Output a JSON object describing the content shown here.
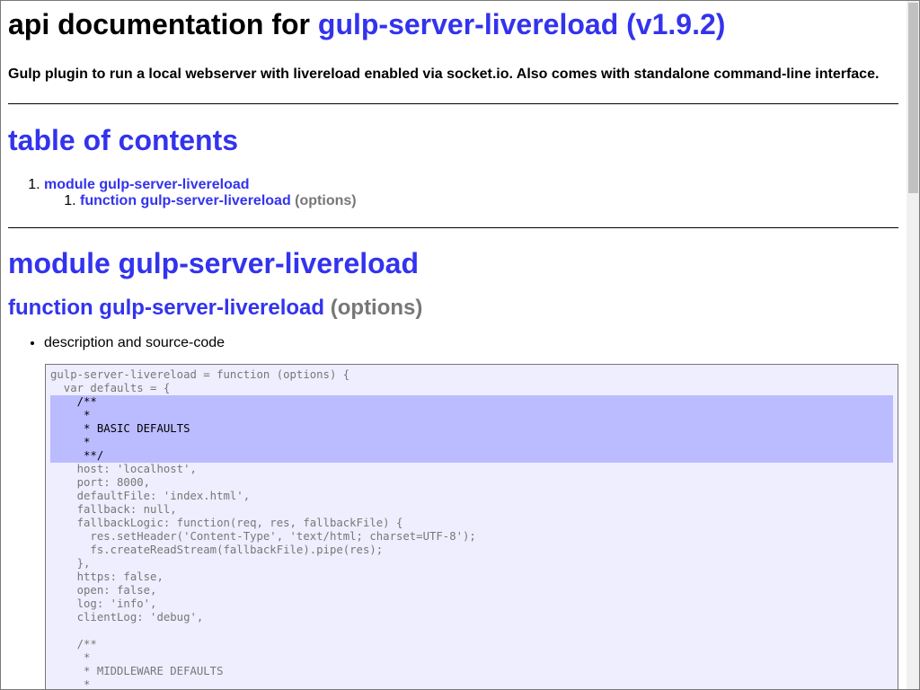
{
  "header": {
    "title_prefix": "api documentation for",
    "title_link": "gulp-server-livereload (v1.9.2)",
    "description": "Gulp plugin to run a local webserver with livereload enabled via socket.io. Also comes with standalone command-line interface."
  },
  "toc": {
    "heading": "table of contents",
    "items": [
      {
        "number": "1.",
        "label": "module gulp-server-livereload"
      },
      {
        "number": "1.",
        "label": "function gulp-server-livereload",
        "args": "(options)"
      }
    ]
  },
  "module": {
    "heading": "module gulp-server-livereload",
    "function_label": "function gulp-server-livereload",
    "function_args": "(options)",
    "bullet": "description and source-code"
  },
  "code": {
    "before": [
      "gulp-server-livereload = function (options) {",
      "  var defaults = {"
    ],
    "highlighted": [
      "    /**",
      "     *",
      "     * BASIC DEFAULTS",
      "     *",
      "     **/"
    ],
    "after": [
      "    host: 'localhost',",
      "    port: 8000,",
      "    defaultFile: 'index.html',",
      "    fallback: null,",
      "    fallbackLogic: function(req, res, fallbackFile) {",
      "      res.setHeader('Content-Type', 'text/html; charset=UTF-8');",
      "      fs.createReadStream(fallbackFile).pipe(res);",
      "    },",
      "    https: false,",
      "    open: false,",
      "    log: 'info',",
      "    clientLog: 'debug',",
      "",
      "    /**",
      "     *",
      "     * MIDDLEWARE DEFAULTS",
      "     *"
    ]
  },
  "colors": {
    "link": "#3333ee",
    "muted": "#777777",
    "code_background": "#eeeeff",
    "code_highlight": "#bbbbff"
  }
}
